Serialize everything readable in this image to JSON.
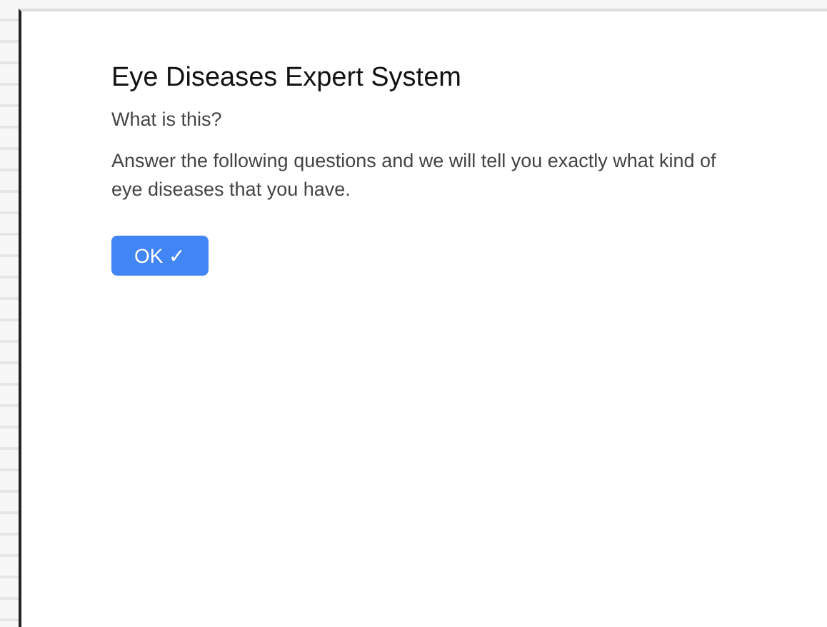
{
  "dialog": {
    "title": "Eye Diseases Expert System",
    "subtitle": "What is this?",
    "description": "Answer the following questions and we will tell you exactly what kind of eye diseases that you have.",
    "button": {
      "label": "OK",
      "icon": "✓"
    }
  }
}
